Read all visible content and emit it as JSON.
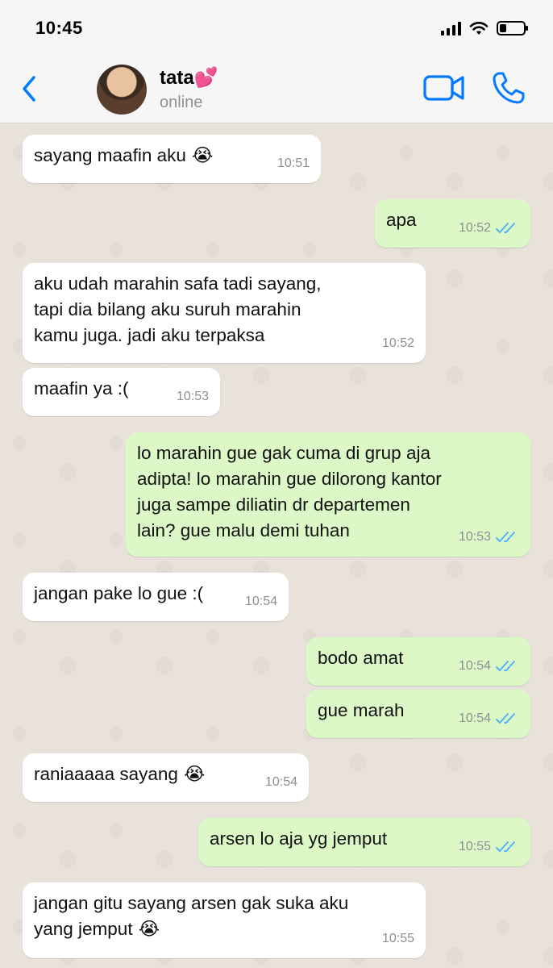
{
  "status_bar": {
    "time": "10:45",
    "battery_level": 0.3
  },
  "header": {
    "contact_name": "tata",
    "name_emoji": "💕",
    "status": "online"
  },
  "colors": {
    "accent": "#007aff",
    "incoming": "#ffffff",
    "outgoing": "#dcf8c6",
    "tick_blue": "#4fb3f6"
  },
  "icons": {
    "back": "chevron-left-icon",
    "video": "video-camera-icon",
    "call": "phone-icon",
    "read": "double-check-icon"
  },
  "messages": [
    {
      "direction": "in",
      "text": "sayang maafin aku",
      "emoji": "😭",
      "time": "10:51"
    },
    {
      "direction": "out",
      "text": "apa",
      "time": "10:52",
      "read": true
    },
    {
      "direction": "in",
      "text": "aku udah marahin safa tadi sayang,\ntapi dia bilang aku suruh marahin\nkamu juga. jadi aku terpaksa",
      "time": "10:52"
    },
    {
      "direction": "in",
      "text": "maafin ya :(",
      "time": "10:53"
    },
    {
      "direction": "out",
      "text": "lo marahin gue gak cuma di grup aja\nadipta! lo marahin gue dilorong kantor\njuga sampe diliatin dr departemen\nlain? gue malu demi tuhan",
      "time": "10:53",
      "read": true
    },
    {
      "direction": "in",
      "text": "jangan pake lo gue :(",
      "time": "10:54"
    },
    {
      "direction": "out",
      "text": "bodo amat",
      "time": "10:54",
      "read": true
    },
    {
      "direction": "out",
      "text": "gue marah",
      "time": "10:54",
      "read": true
    },
    {
      "direction": "in",
      "text": "raniaaaaa sayang",
      "emoji": "😭",
      "time": "10:54"
    },
    {
      "direction": "out",
      "text": "arsen lo aja yg jemput",
      "time": "10:55",
      "read": true
    },
    {
      "direction": "in",
      "text": "jangan gitu sayang arsen gak suka aku\nyang jemput",
      "emoji": "😭",
      "time": "10:55"
    }
  ]
}
